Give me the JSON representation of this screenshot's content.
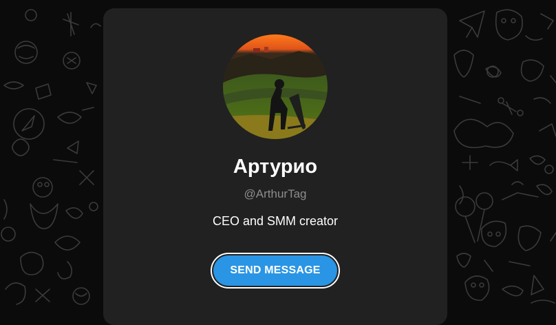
{
  "profile": {
    "name": "Артурио",
    "handle": "@ArthurTag",
    "bio": "CEO and SMM creator"
  },
  "actions": {
    "send_message_label": "SEND MESSAGE"
  },
  "colors": {
    "page_background": "#0b0b0b",
    "card_background": "#212121",
    "accent": "#2a95e4",
    "muted_text": "#8d8d8d"
  },
  "icons": {
    "background_pattern": "doodle-pattern-icons"
  }
}
